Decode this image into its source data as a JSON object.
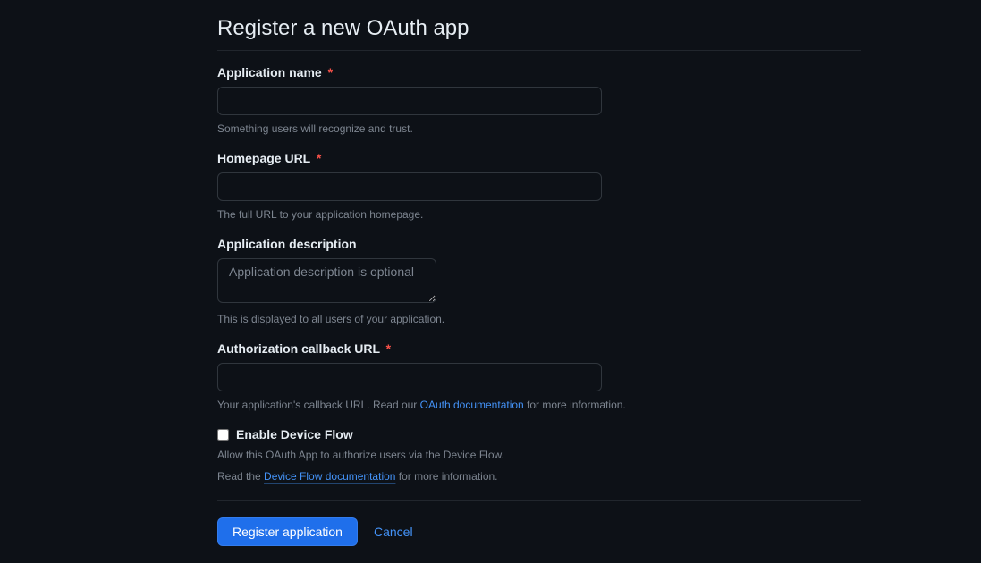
{
  "heading": "Register a new OAuth app",
  "fields": {
    "app_name": {
      "label": "Application name",
      "required_marker": "*",
      "help": "Something users will recognize and trust."
    },
    "homepage_url": {
      "label": "Homepage URL",
      "required_marker": "*",
      "help": "The full URL to your application homepage."
    },
    "app_description": {
      "label": "Application description",
      "placeholder": "Application description is optional",
      "help": "This is displayed to all users of your application."
    },
    "callback_url": {
      "label": "Authorization callback URL",
      "required_marker": "*",
      "help_prefix": "Your application's callback URL. Read our ",
      "help_link_text": "OAuth documentation",
      "help_suffix": " for more information."
    },
    "device_flow": {
      "label": "Enable Device Flow",
      "help_line1": "Allow this OAuth App to authorize users via the Device Flow.",
      "help_line2_prefix": "Read the ",
      "help_line2_link": "Device Flow documentation",
      "help_line2_suffix": " for more information."
    }
  },
  "actions": {
    "submit": "Register application",
    "cancel": "Cancel"
  }
}
